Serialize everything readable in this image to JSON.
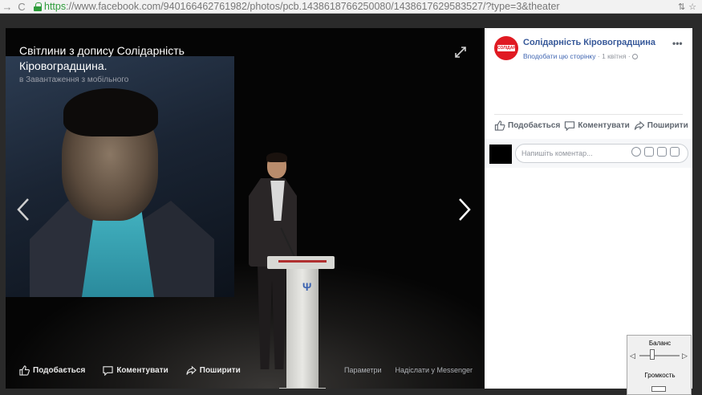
{
  "browser": {
    "url_scheme": "https",
    "url_rest": "://www.facebook.com/940166462761982/photos/pcb.1438618766250080/1438617629583527/?type=3&theater"
  },
  "photo": {
    "title": "Світлини з допису Солідарність Кіровоградщина.",
    "subtitle": "в Завантаження з мобільного",
    "actions": {
      "like": "Подобається",
      "comment": "Коментувати",
      "share": "Поширити"
    },
    "links": {
      "options": "Параметри",
      "send_messenger": "Надіслати у Messenger"
    }
  },
  "post": {
    "page_name": "Солідарність Кіровоградщина",
    "like_page": "Вподобати цю сторінку",
    "dot": "·",
    "date": "1 квітня",
    "more": "•••",
    "avatar_text": "СОЛІДАРНІСТЬ",
    "actions": {
      "like": "Подобається",
      "comment": "Коментувати",
      "share": "Поширити"
    },
    "comment_placeholder": "Напишіть коментар..."
  },
  "volume": {
    "balance_label": "Баланс",
    "volume_label": "Громкость"
  },
  "colors": {
    "facebook_blue": "#365899",
    "link_blue": "#4267b2",
    "secure_green": "#2e9c3b",
    "brand_red": "#e01a22"
  }
}
